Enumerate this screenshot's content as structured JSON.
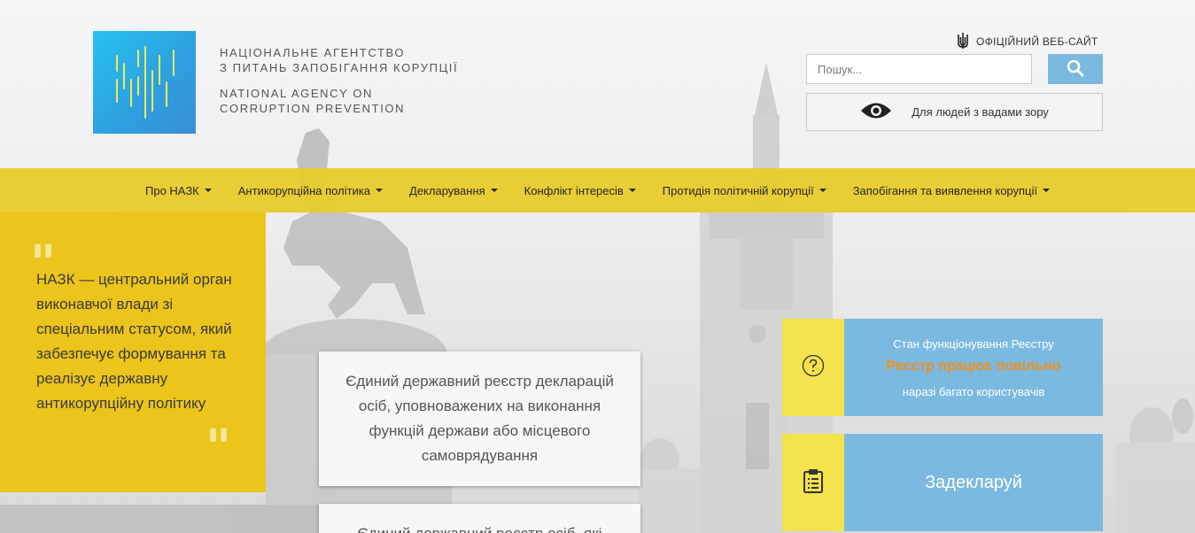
{
  "header": {
    "agency_name_ua_line1": "Національне агентство",
    "agency_name_ua_line2": "з питань запобігання корупції",
    "agency_name_en_line1": "National Agency on",
    "agency_name_en_line2": "Corruption Prevention",
    "official_label": "ОФІЦІЙНИЙ ВЕБ-САЙТ",
    "search_placeholder": "Пошук...",
    "vision_label": "Для людей з вадами зору"
  },
  "nav": {
    "items": [
      {
        "label": "Про НАЗК"
      },
      {
        "label": "Антикорупційна політика"
      },
      {
        "label": "Декларування"
      },
      {
        "label": "Конфлікт інтересів"
      },
      {
        "label": "Протидія політичній корупції"
      },
      {
        "label": "Запобігання та виявлення корупції"
      }
    ]
  },
  "quote": {
    "text": "НАЗК — центральний орган  виконавчої влади зі спеціальним статусом, який забезпечує формування та реалізує державну антикорупційну політику"
  },
  "cards": [
    {
      "text": "Єдиний державний реєстр декларацій осіб, уповноважених на виконання функцій держави або місцевого самоврядування"
    },
    {
      "text": "Єдиний державний реєстр осіб, які"
    }
  ],
  "status": {
    "title": "Стан функціонування Реєстру",
    "value": "Реєстр працює повільно",
    "note": "наразі багато користувачів"
  },
  "declare": {
    "label": "Задекларуй"
  },
  "colors": {
    "nav_yellow": "#e8cc2f",
    "quote_yellow": "#ebc41c",
    "panel_blue": "#7cb9e0",
    "icon_yellow": "#f4e24e",
    "status_orange": "#f0901e",
    "logo_blue": "#2e9fe0"
  }
}
